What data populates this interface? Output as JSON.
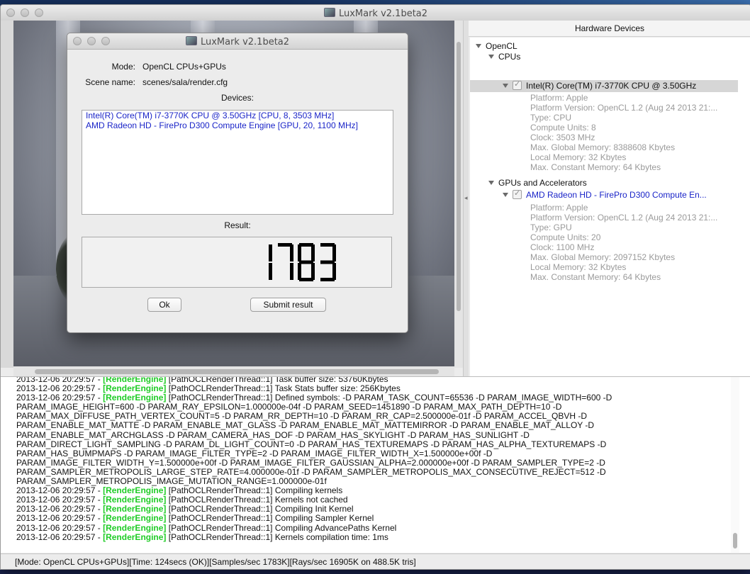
{
  "main_window": {
    "title": "LuxMark v2.1beta2"
  },
  "dialog": {
    "title": "LuxMark v2.1beta2",
    "mode_label": "Mode:",
    "mode_value": "OpenCL CPUs+GPUs",
    "scene_label": "Scene name:",
    "scene_value": "scenes/sala/render.cfg",
    "devices_label": "Devices:",
    "devices": [
      "Intel(R) Core(TM) i7-3770K CPU @ 3.50GHz [CPU, 8, 3503 MHz]",
      "AMD Radeon HD - FirePro D300 Compute Engine [GPU, 20, 1100 MHz]"
    ],
    "result_label": "Result:",
    "result_value": "1783",
    "ok_label": "Ok",
    "submit_label": "Submit result"
  },
  "hardware": {
    "header": "Hardware Devices",
    "root": "OpenCL",
    "cpus_label": "CPUs",
    "cpu_device": "Intel(R) Core(TM) i7-3770K CPU @ 3.50GHz",
    "cpu_props": [
      "Platform: Apple",
      "Platform Version: OpenCL 1.2 (Aug 24 2013 21:...",
      "Type: CPU",
      "Compute Units: 8",
      "Clock: 3503 MHz",
      "Max. Global Memory: 8388608 Kbytes",
      "Local Memory: 32 Kbytes",
      "Max. Constant Memory: 64 Kbytes"
    ],
    "gpus_label": "GPUs and Accelerators",
    "gpu_device": "AMD Radeon HD - FirePro D300 Compute En...",
    "gpu_props": [
      "Platform: Apple",
      "Platform Version: OpenCL 1.2 (Aug 24 2013 21:...",
      "Type: GPU",
      "Compute Units: 20",
      "Clock: 1100 MHz",
      "Max. Global Memory: 2097152 Kbytes",
      "Local Memory: 32 Kbytes",
      "Max. Constant Memory: 64 Kbytes"
    ]
  },
  "log": [
    {
      "ts": "2013-12-06 20:29:57 - ",
      "tag": "[RenderEngine]",
      "msg": " [PathOCLRenderThread::1] Task buffer size: 53760Kbytes"
    },
    {
      "ts": "2013-12-06 20:29:57 - ",
      "tag": "[RenderEngine]",
      "msg": " [PathOCLRenderThread::1] Task Stats buffer size: 256Kbytes"
    },
    {
      "ts": "2013-12-06 20:29:57 - ",
      "tag": "[RenderEngine]",
      "msg": " [PathOCLRenderThread::1] Defined symbols: -D PARAM_TASK_COUNT=65536 -D PARAM_IMAGE_WIDTH=600 -D"
    },
    {
      "ts": "",
      "tag": "",
      "msg": "PARAM_IMAGE_HEIGHT=600 -D PARAM_RAY_EPSILON=1.000000e-04f -D PARAM_SEED=1451890 -D PARAM_MAX_PATH_DEPTH=10 -D"
    },
    {
      "ts": "",
      "tag": "",
      "msg": "PARAM_MAX_DIFFUSE_PATH_VERTEX_COUNT=5 -D PARAM_RR_DEPTH=10 -D PARAM_RR_CAP=2.500000e-01f -D PARAM_ACCEL_QBVH -D"
    },
    {
      "ts": "",
      "tag": "",
      "msg": "PARAM_ENABLE_MAT_MATTE -D PARAM_ENABLE_MAT_GLASS -D PARAM_ENABLE_MAT_MATTEMIRROR -D PARAM_ENABLE_MAT_ALLOY -D"
    },
    {
      "ts": "",
      "tag": "",
      "msg": "PARAM_ENABLE_MAT_ARCHGLASS -D PARAM_CAMERA_HAS_DOF -D PARAM_HAS_SKYLIGHT -D PARAM_HAS_SUNLIGHT -D"
    },
    {
      "ts": "",
      "tag": "",
      "msg": "PARAM_DIRECT_LIGHT_SAMPLING -D PARAM_DL_LIGHT_COUNT=0 -D PARAM_HAS_TEXTUREMAPS -D PARAM_HAS_ALPHA_TEXTUREMAPS -D"
    },
    {
      "ts": "",
      "tag": "",
      "msg": "PARAM_HAS_BUMPMAPS -D PARAM_IMAGE_FILTER_TYPE=2 -D PARAM_IMAGE_FILTER_WIDTH_X=1.500000e+00f -D"
    },
    {
      "ts": "",
      "tag": "",
      "msg": "PARAM_IMAGE_FILTER_WIDTH_Y=1.500000e+00f -D PARAM_IMAGE_FILTER_GAUSSIAN_ALPHA=2.000000e+00f -D PARAM_SAMPLER_TYPE=2 -D"
    },
    {
      "ts": "",
      "tag": "",
      "msg": "PARAM_SAMPLER_METROPOLIS_LARGE_STEP_RATE=4.000000e-01f -D PARAM_SAMPLER_METROPOLIS_MAX_CONSECUTIVE_REJECT=512 -D"
    },
    {
      "ts": "",
      "tag": "",
      "msg": "PARAM_SAMPLER_METROPOLIS_IMAGE_MUTATION_RANGE=1.000000e-01f"
    },
    {
      "ts": "2013-12-06 20:29:57 - ",
      "tag": "[RenderEngine]",
      "msg": " [PathOCLRenderThread::1] Compiling kernels"
    },
    {
      "ts": "2013-12-06 20:29:57 - ",
      "tag": "[RenderEngine]",
      "msg": " [PathOCLRenderThread::1] Kernels not cached"
    },
    {
      "ts": "2013-12-06 20:29:57 - ",
      "tag": "[RenderEngine]",
      "msg": " [PathOCLRenderThread::1] Compiling Init Kernel"
    },
    {
      "ts": "2013-12-06 20:29:57 - ",
      "tag": "[RenderEngine]",
      "msg": " [PathOCLRenderThread::1] Compiling Sampler Kernel"
    },
    {
      "ts": "2013-12-06 20:29:57 - ",
      "tag": "[RenderEngine]",
      "msg": " [PathOCLRenderThread::1] Compiling AdvancePaths Kernel"
    },
    {
      "ts": "2013-12-06 20:29:57 - ",
      "tag": "[RenderEngine]",
      "msg": " [PathOCLRenderThread::1] Kernels compilation time: 1ms"
    }
  ],
  "status_bar": "[Mode: OpenCL CPUs+GPUs][Time: 124secs (OK)][Samples/sec  1783K][Rays/sec  16905K on 488.5K tris]",
  "colors": {
    "log_tag": "#1fcc26",
    "device_text": "#1a24c8"
  }
}
